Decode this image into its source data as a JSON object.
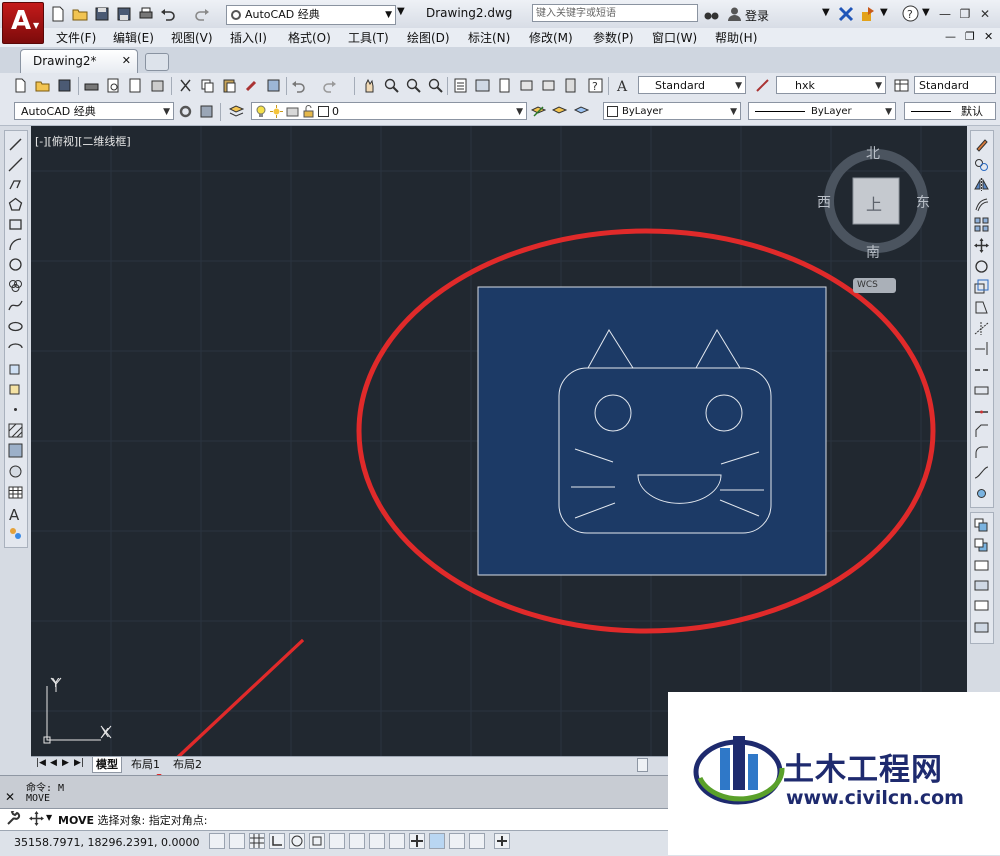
{
  "titlebar": {
    "workspace": "AutoCAD 经典",
    "document_title": "Drawing2.dwg",
    "search_placeholder": "键入关键字或短语",
    "login": "登录"
  },
  "menu": [
    "文件(F)",
    "编辑(E)",
    "视图(V)",
    "插入(I)",
    "格式(O)",
    "工具(T)",
    "绘图(D)",
    "标注(N)",
    "修改(M)",
    "参数(P)",
    "窗口(W)",
    "帮助(H)"
  ],
  "tabs": {
    "active": "Drawing2*"
  },
  "toolbar": {
    "text_style": "Standard",
    "dim_style": "hxk",
    "table_style": "Standard",
    "workspace2": "AutoCAD 经典",
    "layer": "0",
    "color": "ByLayer",
    "linetype": "ByLayer",
    "lineweight": "默认"
  },
  "viewport": {
    "label": "[-][俯视][二维线框]"
  },
  "viewcube": {
    "north": "北",
    "south": "南",
    "east": "东",
    "west": "西",
    "top": "上",
    "wcs": "WCS"
  },
  "ucs": {
    "x": "X",
    "y": "Y"
  },
  "layout_tabs": [
    "模型",
    "布局1",
    "布局2"
  ],
  "command": {
    "history": [
      "命令: M",
      "MOVE"
    ],
    "input_cmd": "MOVE",
    "prompt": "选择对象: 指定对角点:"
  },
  "status": {
    "coords": "35158.7971, 18296.2391, 0.0000"
  },
  "watermark": {
    "title": "土木工程网",
    "url": "www.civilcn.com"
  },
  "colors": {
    "canvas": "#212830",
    "selection": "#1c3a66",
    "annotation": "#e02a2a",
    "logo": "#b51414"
  }
}
